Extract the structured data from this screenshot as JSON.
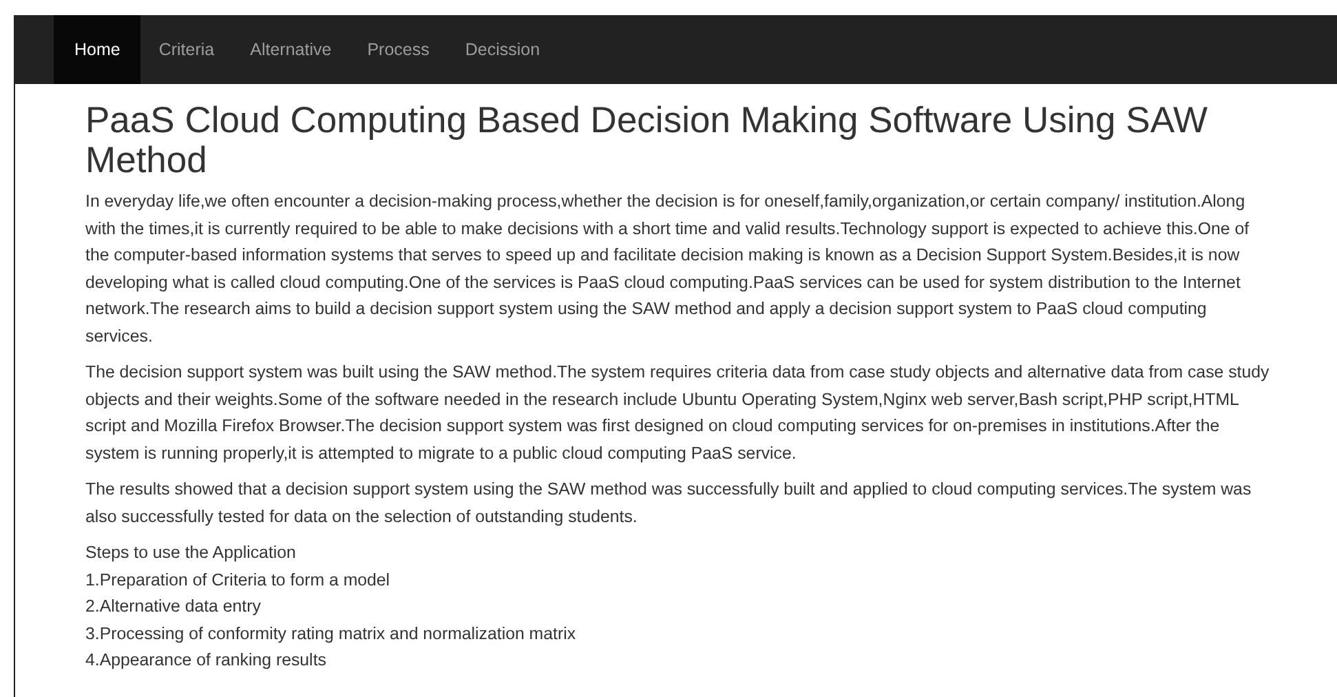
{
  "navbar": {
    "items": [
      {
        "label": "Home",
        "selected": true
      },
      {
        "label": "Criteria",
        "selected": false
      },
      {
        "label": "Alternative",
        "selected": false
      },
      {
        "label": "Process",
        "selected": false
      },
      {
        "label": "Decission",
        "selected": false
      }
    ]
  },
  "title": "PaaS Cloud Computing Based Decision Making Software Using SAW Method",
  "paragraphs": [
    "In everyday life,we often encounter a decision-making process,whether the decision is for oneself,family,organization,or certain company/ institution.Along with the times,it is currently required to be able to make decisions with a short time and valid results.Technology support is expected to achieve this.One of the computer-based information systems that serves to speed up and facilitate decision making is known as a Decision Support System.Besides,it is now developing what is called cloud computing.One of the services is PaaS cloud computing.PaaS services can be used for system distribution to the Internet network.The research aims to build a decision support system using the SAW method and apply a decision support system to PaaS cloud computing services.",
    "The decision support system was built using the SAW method.The system requires criteria data from case study objects and alternative data from case study objects and their weights.Some of the software needed in the research include Ubuntu Operating System,Nginx web server,Bash script,PHP script,HTML script and Mozilla Firefox Browser.The decision support system was first designed on cloud computing services for on-premises in institutions.After the system is running properly,it is attempted to migrate to a public cloud computing PaaS service.",
    "The results showed that a decision support system using the SAW method was successfully built and applied to cloud computing services.The system was also successfully tested for data on the selection of outstanding students."
  ],
  "steps": {
    "heading": "Steps to use the Application",
    "items": [
      "1.Preparation of Criteria to form a model",
      "2.Alternative data entry",
      "3.Processing of conformity rating matrix and normalization matrix",
      "4.Appearance of ranking results"
    ]
  }
}
